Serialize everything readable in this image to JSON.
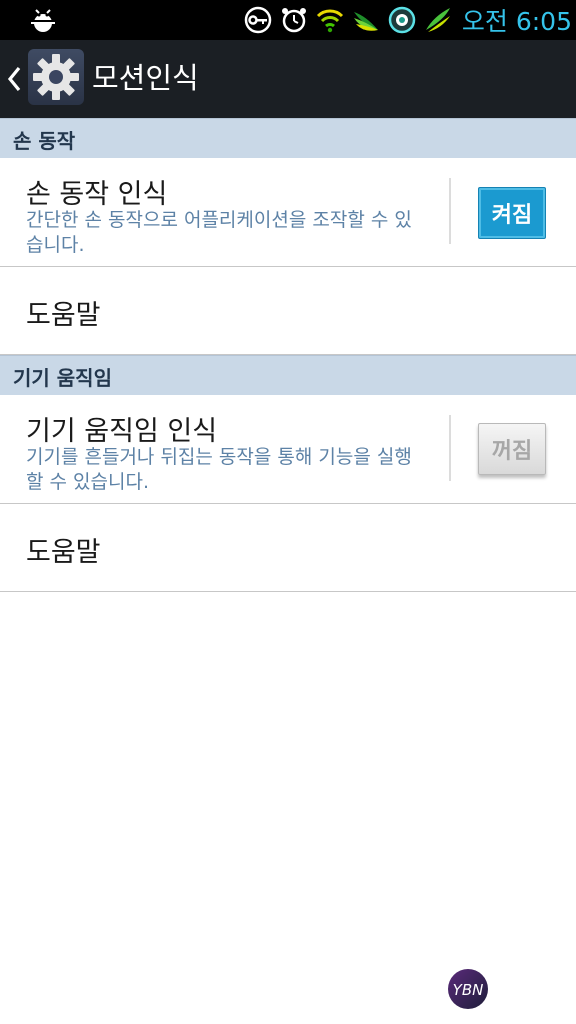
{
  "status_bar": {
    "time": "오전 6:05",
    "icons": [
      "bug-icon",
      "key-icon",
      "alarm-icon",
      "wifi-icon",
      "wing-icon",
      "compass-icon",
      "feather-icon"
    ],
    "accent_color": "#35c3ea"
  },
  "app_bar": {
    "title": "모션인식",
    "icon": "gear-icon",
    "back_icon": "chevron-left-icon"
  },
  "sections": [
    {
      "header": "손 동작",
      "item": {
        "title": "손 동작 인식",
        "summary": "간단한 손 동작으로 어플리케이션을 조작할 수 있습니다.",
        "toggle_label": "켜짐",
        "toggle_state": "on"
      },
      "help": "도움말"
    },
    {
      "header": "기기 움직임",
      "item": {
        "title": "기기 움직임 인식",
        "summary": "기기를 흔들거나 뒤집는 동작을 통해 기능을 실행할 수 있습니다.",
        "toggle_label": "꺼짐",
        "toggle_state": "off"
      },
      "help": "도움말"
    }
  ],
  "colors": {
    "section_header_bg": "#c9d8e7",
    "toggle_on": "#1b9ad0",
    "summary_text": "#5d82a6",
    "app_bar_bg": "#1b1f24"
  },
  "watermark": "YBN"
}
